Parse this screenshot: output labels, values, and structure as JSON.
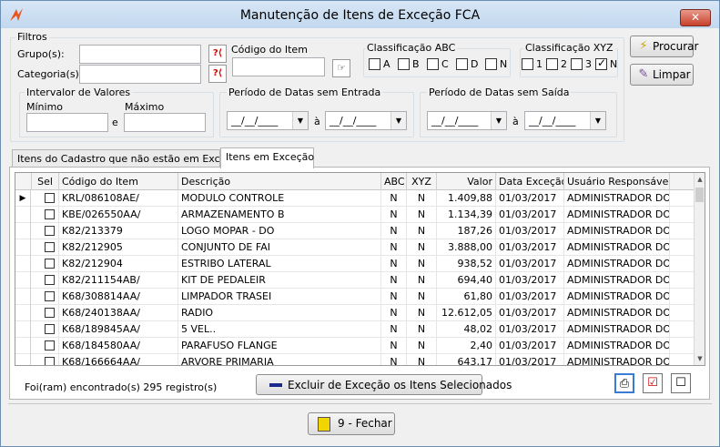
{
  "window": {
    "title": "Manutenção de Itens de Exceção FCA",
    "close_label": "✕"
  },
  "filters": {
    "legend": "Filtros",
    "grupo_label": "Grupo(s):",
    "categoria_label": "Categoria(s):",
    "codigo_item_label": "Código do Item",
    "classificacao_abc": {
      "legend": "Classificação ABC",
      "options": [
        {
          "label": "A",
          "checked": false
        },
        {
          "label": "B",
          "checked": false
        },
        {
          "label": "C",
          "checked": false
        },
        {
          "label": "D",
          "checked": false
        },
        {
          "label": "N",
          "checked": false
        }
      ]
    },
    "classificacao_xyz": {
      "legend": "Classificação XYZ",
      "options": [
        {
          "label": "1",
          "checked": false
        },
        {
          "label": "2",
          "checked": false
        },
        {
          "label": "3",
          "checked": false
        },
        {
          "label": "N",
          "checked": true
        }
      ]
    },
    "intervalo": {
      "legend": "Intervalor de Valores",
      "minimo_label": "Mínimo",
      "maximo_label": "Máximo",
      "e_label": "e"
    },
    "periodo_entrada": {
      "legend": "Período de Datas sem Entrada",
      "from": "__/__/____",
      "to": "__/__/____",
      "a_label": "à"
    },
    "periodo_saida": {
      "legend": "Período de Datas sem Saída",
      "from": "__/__/____",
      "to": "__/__/____",
      "a_label": "à"
    }
  },
  "actions": {
    "procurar_label": "Procurar",
    "limpar_label": "Limpar"
  },
  "tabs": [
    {
      "label": "Itens do Cadastro que não estão em Exceção",
      "active": false
    },
    {
      "label": "Itens em Exceção",
      "active": true
    }
  ],
  "grid": {
    "columns": [
      "Sel",
      "Código do Item",
      "Descrição",
      "ABC",
      "XYZ",
      "Valor",
      "Data Exceção",
      "Usuário Responsável"
    ],
    "rows": [
      {
        "codigo": "KRL/086108AE/",
        "descricao": "MODULO CONTROLE",
        "abc": "N",
        "xyz": "N",
        "valor": "1.409,88",
        "data": "01/03/2017",
        "usuario": "ADMINISTRADOR DO S",
        "current": true
      },
      {
        "codigo": "KBE/026550AA/",
        "descricao": "ARMAZENAMENTO B",
        "abc": "N",
        "xyz": "N",
        "valor": "1.134,39",
        "data": "01/03/2017",
        "usuario": "ADMINISTRADOR DO S",
        "current": false
      },
      {
        "codigo": "K82/213379",
        "descricao": "LOGO MOPAR - DO",
        "abc": "N",
        "xyz": "N",
        "valor": "187,26",
        "data": "01/03/2017",
        "usuario": "ADMINISTRADOR DO S",
        "current": false
      },
      {
        "codigo": "K82/212905",
        "descricao": "CONJUNTO DE FAI",
        "abc": "N",
        "xyz": "N",
        "valor": "3.888,00",
        "data": "01/03/2017",
        "usuario": "ADMINISTRADOR DO S",
        "current": false
      },
      {
        "codigo": "K82/212904",
        "descricao": "ESTRIBO LATERAL",
        "abc": "N",
        "xyz": "N",
        "valor": "938,52",
        "data": "01/03/2017",
        "usuario": "ADMINISTRADOR DO S",
        "current": false
      },
      {
        "codigo": "K82/211154AB/",
        "descricao": "KIT DE PEDALEIR",
        "abc": "N",
        "xyz": "N",
        "valor": "694,40",
        "data": "01/03/2017",
        "usuario": "ADMINISTRADOR DO S",
        "current": false
      },
      {
        "codigo": "K68/308814AA/",
        "descricao": "LIMPADOR TRASEI",
        "abc": "N",
        "xyz": "N",
        "valor": "61,80",
        "data": "01/03/2017",
        "usuario": "ADMINISTRADOR DO S",
        "current": false
      },
      {
        "codigo": "K68/240138AA/",
        "descricao": "RADIO",
        "abc": "N",
        "xyz": "N",
        "valor": "12.612,05",
        "data": "01/03/2017",
        "usuario": "ADMINISTRADOR DO S",
        "current": false
      },
      {
        "codigo": "K68/189845AA/",
        "descricao": "5 VEL..",
        "abc": "N",
        "xyz": "N",
        "valor": "48,02",
        "data": "01/03/2017",
        "usuario": "ADMINISTRADOR DO S",
        "current": false
      },
      {
        "codigo": "K68/184580AA/",
        "descricao": "PARAFUSO FLANGE",
        "abc": "N",
        "xyz": "N",
        "valor": "2,40",
        "data": "01/03/2017",
        "usuario": "ADMINISTRADOR DO S",
        "current": false
      },
      {
        "codigo": "K68/166664AA/",
        "descricao": "ARVORE PRIMARIA",
        "abc": "N",
        "xyz": "N",
        "valor": "643,17",
        "data": "01/03/2017",
        "usuario": "ADMINISTRADOR DO S",
        "current": false
      }
    ]
  },
  "footer": {
    "status_text": "Foi(ram) encontrado(s) 295 registro(s)",
    "excluir_label": "Excluir de Exceção os Itens Selecionados",
    "fechar_label": "9 - Fechar"
  },
  "colors": {
    "title_bg": "#c9dcf0",
    "close_red": "#c7412b",
    "focus_blue": "#3a7bd5"
  }
}
